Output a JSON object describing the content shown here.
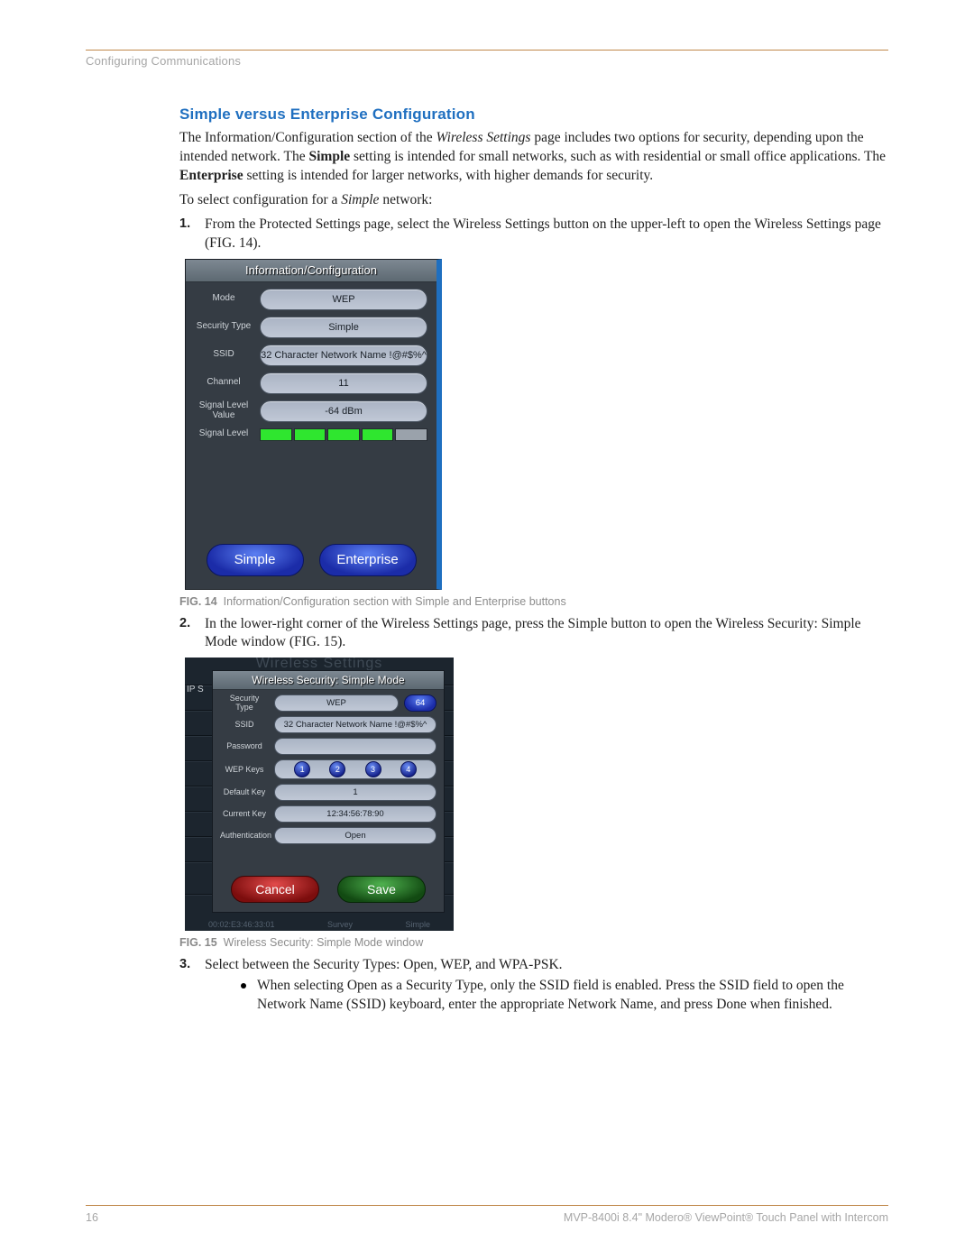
{
  "header": {
    "section": "Configuring Communications"
  },
  "title": "Simple versus Enterprise Configuration",
  "intro_parts": [
    {
      "t": "The Information/Configuration section of the "
    },
    {
      "t": "Wireless Settings",
      "cls": "em"
    },
    {
      "t": " page includes two options for security, depending upon the intended network. The "
    },
    {
      "t": "Simple",
      "cls": "b"
    },
    {
      "t": " setting is intended for small networks, such as with residential or small office applications. The "
    },
    {
      "t": "Enterprise",
      "cls": "b"
    },
    {
      "t": " setting is intended for larger networks, with higher demands for security."
    }
  ],
  "intro2_parts": [
    {
      "t": "To select configuration for a "
    },
    {
      "t": "Simple",
      "cls": "em"
    },
    {
      "t": " network:"
    }
  ],
  "step1_parts": [
    {
      "t": "From the "
    },
    {
      "t": "Protected Settings",
      "cls": "em"
    },
    {
      "t": " page, select the "
    },
    {
      "t": "Wireless Settings",
      "cls": "b"
    },
    {
      "t": " button on the upper-left to open the "
    },
    {
      "t": "Wireless Settings",
      "cls": "em"
    },
    {
      "t": " page (FIG. 14)."
    }
  ],
  "step2_parts": [
    {
      "t": "In the lower-right corner of the "
    },
    {
      "t": "Wireless Settings",
      "cls": "em"
    },
    {
      "t": " page, press the "
    },
    {
      "t": "Simple",
      "cls": "b"
    },
    {
      "t": " button to open the "
    },
    {
      "t": "Wireless Security: Simple Mode",
      "cls": "em"
    },
    {
      "t": " window (FIG. 15)."
    }
  ],
  "step3_text": "Select between the Security Types: Open, WEP, and WPA-PSK.",
  "step3_bullet_parts": [
    {
      "t": "When selecting "
    },
    {
      "t": "Open",
      "cls": "em"
    },
    {
      "t": " as a Security Type, only the "
    },
    {
      "t": "SSID",
      "cls": "em"
    },
    {
      "t": " field is enabled. Press the "
    },
    {
      "t": "SSID",
      "cls": "em"
    },
    {
      "t": " field to open the "
    },
    {
      "t": "Network Name (SSID)",
      "cls": "em"
    },
    {
      "t": " keyboard, enter the appropriate Network Name, and press "
    },
    {
      "t": "Done",
      "cls": "b"
    },
    {
      "t": " when finished."
    }
  ],
  "fig14": {
    "title": "Information/Configuration",
    "rows": {
      "mode": {
        "label": "Mode",
        "value": "WEP"
      },
      "security": {
        "label": "Security Type",
        "value": "Simple"
      },
      "ssid": {
        "label": "SSID",
        "value": "32 Character Network Name !@#$%^"
      },
      "channel": {
        "label": "Channel",
        "value": "11"
      },
      "siglevelval": {
        "label": "Signal Level Value",
        "value": "-64 dBm"
      },
      "siglevel": {
        "label": "Signal Level",
        "bars_on": 4,
        "bars_total": 5
      }
    },
    "buttons": {
      "simple": "Simple",
      "enterprise": "Enterprise"
    },
    "caption_fig": "FIG. 14",
    "caption_text": "Information/Configuration section with Simple and Enterprise buttons"
  },
  "fig15": {
    "ghost_title": "Wireless Settings",
    "edge_left": "IP S",
    "dialog_title": "Wireless Security: Simple Mode",
    "rows": {
      "security": {
        "label": "Security Type",
        "value": "WEP",
        "chip": "64"
      },
      "ssid": {
        "label": "SSID",
        "value": "32 Character Network Name !@#$%^"
      },
      "password": {
        "label": "Password",
        "value": ""
      },
      "wepkeys": {
        "label": "WEP Keys",
        "keys": [
          "1",
          "2",
          "3",
          "4"
        ]
      },
      "defaultkey": {
        "label": "Default Key",
        "value": "1"
      },
      "currentkey": {
        "label": "Current Key",
        "value": "12:34:56:78:90"
      },
      "auth": {
        "label": "Authentication",
        "value": "Open"
      }
    },
    "buttons": {
      "cancel": "Cancel",
      "save": "Save"
    },
    "footer_ghost": {
      "left": "Survey",
      "right": "Simple",
      "mac": "00:02:E3:46:33:01"
    },
    "caption_fig": "FIG. 15",
    "caption_text": "Wireless Security: Simple Mode window"
  },
  "footer": {
    "page": "16",
    "product": "MVP-8400i 8.4\" Modero® ViewPoint® Touch Panel with Intercom"
  }
}
